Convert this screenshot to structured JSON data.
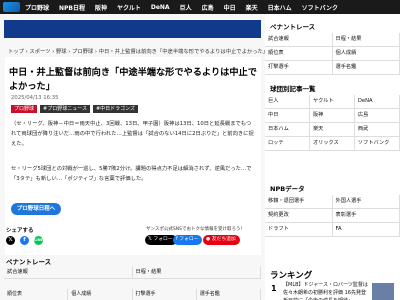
{
  "nav": {
    "items": [
      "プロ野球",
      "NPB日程",
      "阪神",
      "ヤクルト",
      "DeNA",
      "巨人",
      "広島",
      "中日",
      "楽天",
      "日本ハム",
      "ソフトバンク"
    ]
  },
  "breadcrumb": "トップ › スポーツ › 野球 › プロ野球 › 中日・井上監督は前向き「中途半端な形でやるよりは中止でよかった」",
  "article": {
    "title": "中日・井上監督は前向き「中途半端な形でやるよりは中止でよかった」",
    "date": "2025/04/13 16:35",
    "tags": [
      "プロ野球",
      "#プロ野球ニュース",
      "#中日ドラゴンズ"
    ],
    "paragraph1": "（セ・リーグ、阪神－中日＝雨天中止、3回戦、13日、甲子園）阪神は13日、10日と延長戦までもつれて両球団が降り注いだ…雨の中で行われた…上監督は「試合のない14日に2日ぶりだ」と前向きに捉えた。",
    "paragraph2": "セ・リーグ5球団との対戦が一巡し、5勝7敗2分け。課題の得点力不足は解消されず、逆風だった…で「3タテ」も新しい…「ポジティブ」な言葉で評価した。",
    "more_button": "プロ野球日程へ"
  },
  "share": {
    "label": "シェアする",
    "follow_text": "サンスポ公式SNSでおトクな情報を受け取ろう！",
    "buttons": [
      "フォロー",
      "フォロー",
      "友だち追加"
    ]
  },
  "bottom": {
    "section_title": "ペナントレース",
    "links": [
      [
        "試合速報",
        "日程・結果"
      ],
      [
        "順位表",
        "個人成績"
      ]
    ],
    "row": [
      "試合速報",
      "日程・結果",
      "打撃選手",
      "選手名鑑"
    ]
  },
  "sidebar": {
    "pennant_title": "ペナントレース",
    "pennant_links": [
      [
        "試合速報",
        "日程・結果"
      ],
      [
        "順位表",
        "個人成績"
      ],
      [
        "打撃選手",
        "選手名鑑"
      ]
    ],
    "teams_title": "球団別記事一覧",
    "teams": [
      [
        "巨人",
        "ヤクルト",
        "DeNA"
      ],
      [
        "中日",
        "阪神",
        "広島"
      ],
      [
        "日本ハム",
        "楽天",
        "西武"
      ],
      [
        "ロッテ",
        "オリックス",
        "ソフトバンク"
      ]
    ],
    "npb_title": "NPBデータ",
    "npb_links": [
      [
        "移籍・退団選手",
        "外国人選手"
      ],
      [
        "契約更改",
        "表彰選手"
      ],
      [
        "ドラフト",
        "FA"
      ]
    ]
  },
  "ranking": {
    "title": "ランキング",
    "rank": "1",
    "text": "【MLB】ドジャース・ロバーツ監督は佐々木朗希の初勝利を評価 16先発登板目前に「今後の成長を期待」"
  },
  "colors": {
    "accent": "#123a8c",
    "tag_red": "#c8102e",
    "button_blue": "#1e78dc"
  }
}
